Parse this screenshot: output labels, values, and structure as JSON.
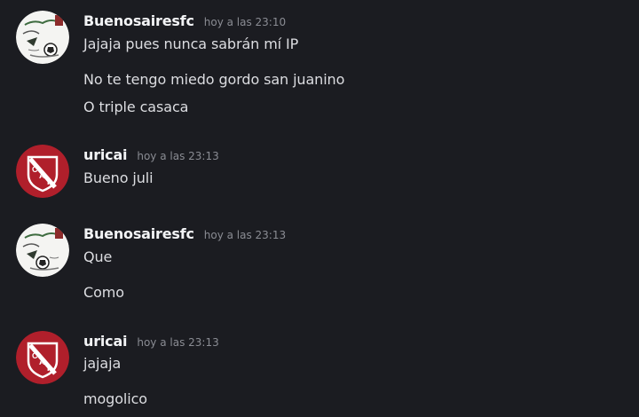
{
  "colors": {
    "background": "#1b1c21",
    "username": "#f2f3f5",
    "message_text": "#dcdde1",
    "timestamp": "#8a8c93",
    "independiente_red": "#b01f2b"
  },
  "messages": [
    {
      "author": "Buenosairesfc",
      "timestamp": "hoy a las 23:10",
      "avatar_icon": "buenosairesfc-avatar-icon",
      "lines": [
        "Jajaja pues nunca sabrán mí IP",
        "No te tengo miedo gordo san juanino",
        "O triple casaca"
      ]
    },
    {
      "author": "uricai",
      "timestamp": "hoy a las 23:13",
      "avatar_icon": "independiente-crest-icon",
      "lines": [
        "Bueno juli"
      ]
    },
    {
      "author": "Buenosairesfc",
      "timestamp": "hoy a las 23:13",
      "avatar_icon": "buenosairesfc-avatar-icon",
      "lines": [
        "Que",
        "Como"
      ]
    },
    {
      "author": "uricai",
      "timestamp": "hoy a las 23:13",
      "avatar_icon": "independiente-crest-icon",
      "lines": [
        "jajaja",
        "mogolico"
      ]
    }
  ]
}
